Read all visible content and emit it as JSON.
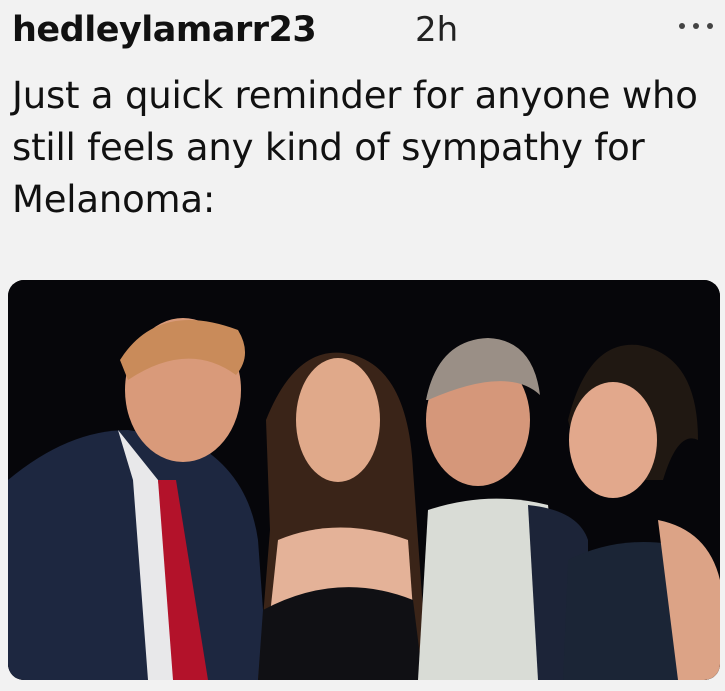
{
  "post": {
    "username": "hedleylamarr23",
    "timestamp": "2h",
    "more_icon": "ellipsis-icon",
    "text": "Just a quick reminder for anyone who still feels any kind of sympathy for Melanoma:"
  },
  "media": {
    "type": "photo"
  }
}
